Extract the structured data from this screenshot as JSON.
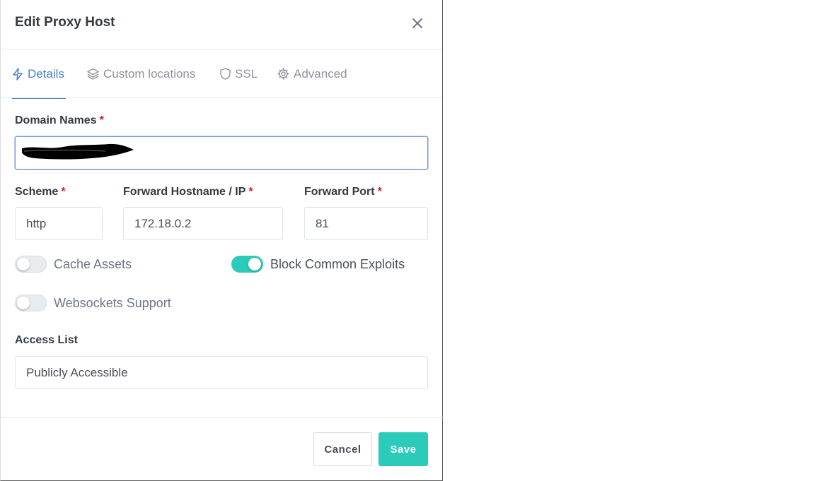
{
  "modal": {
    "title": "Edit Proxy Host",
    "close_icon": "close-icon"
  },
  "tabs": [
    {
      "label": "Details",
      "icon": "lightning-icon",
      "active": true
    },
    {
      "label": "Custom locations",
      "icon": "layers-icon",
      "active": false
    },
    {
      "label": "SSL",
      "icon": "shield-icon",
      "active": false
    },
    {
      "label": "Advanced",
      "icon": "gear-icon",
      "active": false
    }
  ],
  "form": {
    "domain_names": {
      "label": "Domain Names",
      "required_mark": "*",
      "value": ""
    },
    "scheme": {
      "label": "Scheme",
      "required_mark": "*",
      "value": "http"
    },
    "forward_hostname": {
      "label": "Forward Hostname / IP",
      "required_mark": "*",
      "value": "172.18.0.2"
    },
    "forward_port": {
      "label": "Forward Port",
      "required_mark": "*",
      "value": "81"
    },
    "toggles": {
      "cache_assets": {
        "label": "Cache Assets",
        "on": false
      },
      "block_common_exploits": {
        "label": "Block Common Exploits",
        "on": true
      },
      "websockets_support": {
        "label": "Websockets Support",
        "on": false
      }
    },
    "access_list": {
      "label": "Access List",
      "value": "Publicly Accessible"
    }
  },
  "footer": {
    "cancel_label": "Cancel",
    "save_label": "Save"
  },
  "colors": {
    "accent": "#467fcf",
    "toggle_on": "#2bcbba",
    "save_button": "#2bcbba",
    "required": "#cd201f"
  }
}
